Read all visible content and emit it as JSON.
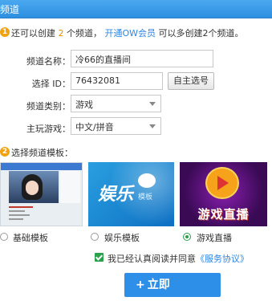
{
  "titlebar": {
    "title": "频道"
  },
  "info": {
    "icon": "1",
    "prefix": "还可以创建",
    "count": "2",
    "mid": "个频道，",
    "link": "开通OW会员",
    "suffix": "可以多创建2个频道。"
  },
  "form": {
    "name_label": "频道名称：",
    "name_value": "冷66的直播间",
    "id_label": "选择 ID：",
    "id_value": "76432081",
    "id_button": "自主选号",
    "category_label": "频道类别：",
    "category_value": "游戏",
    "game_label": "主玩游戏：",
    "game_value": "中文/拼音"
  },
  "templates": {
    "icon": "2",
    "heading": "选择频道模板：",
    "items": [
      {
        "label": "基础模板",
        "selected": false
      },
      {
        "label": "娱乐模板",
        "selected": false
      },
      {
        "label": "游戏直播",
        "selected": true
      }
    ],
    "thumb2_text": "娱乐",
    "thumb2_sub": "模板",
    "thumb3_text": "游戏直播"
  },
  "agreement": {
    "checked": true,
    "text": "我已经认真阅读并同意",
    "link": "《服务协议》"
  },
  "submit": {
    "label": "立即"
  },
  "colors": {
    "accent": "#2d8fe8",
    "orange": "#f3a20f",
    "green": "#2aa24b"
  }
}
